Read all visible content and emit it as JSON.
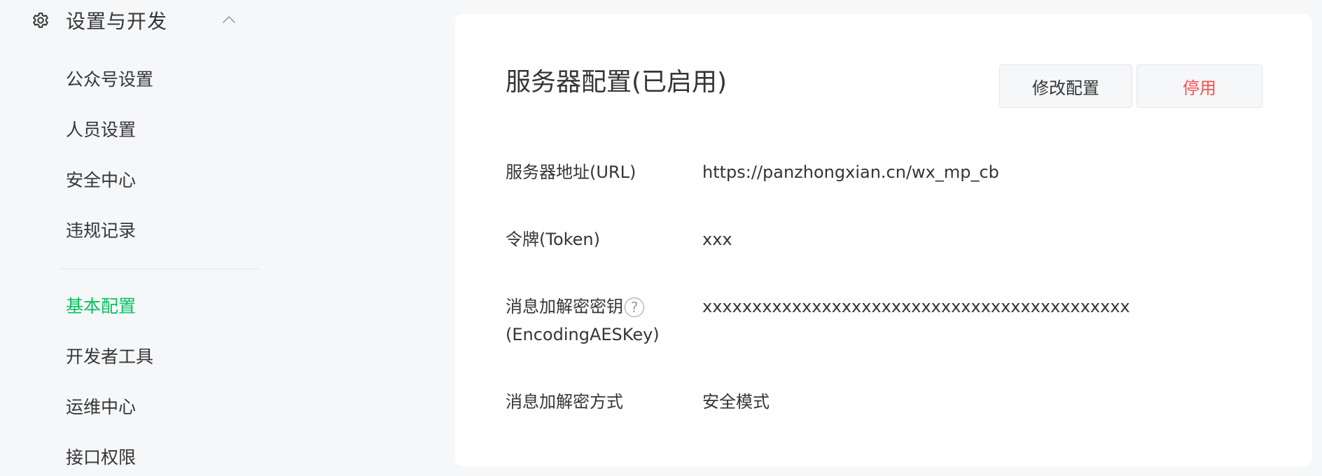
{
  "sidebar": {
    "section_title": "设置与开发",
    "section_icon": "gear-icon",
    "collapse_icon": "chevron-up-icon",
    "items": [
      {
        "label": "公众号设置"
      },
      {
        "label": "人员设置"
      },
      {
        "label": "安全中心"
      },
      {
        "label": "违规记录"
      },
      {
        "label": "基本配置",
        "active": true
      },
      {
        "label": "开发者工具"
      },
      {
        "label": "运维中心"
      },
      {
        "label": "接口权限"
      }
    ],
    "active_color": "#07c160"
  },
  "card": {
    "title": "服务器配置(已启用)",
    "buttons": {
      "edit_label": "修改配置",
      "disable_label": "停用",
      "disable_color": "#fa5151"
    },
    "fields": [
      {
        "label": "服务器地址(URL)",
        "value": "https://panzhongxian.cn/wx_mp_cb"
      },
      {
        "label": "令牌(Token)",
        "value": "xxx"
      },
      {
        "label_line1": "消息加解密密钥",
        "label_line2": "(EncodingAESKey)",
        "help_icon": "?",
        "value": "xxxxxxxxxxxxxxxxxxxxxxxxxxxxxxxxxxxxxxxxxxx"
      },
      {
        "label": "消息加解密方式",
        "value": "安全模式"
      }
    ]
  }
}
